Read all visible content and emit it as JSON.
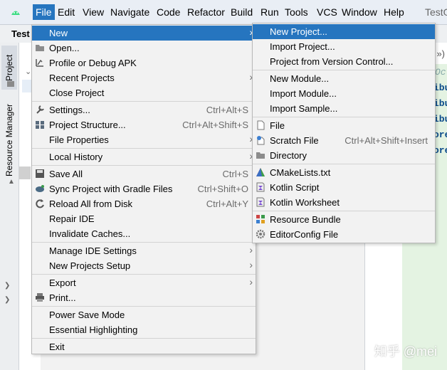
{
  "menubar": {
    "items": [
      "File",
      "Edit",
      "View",
      "Navigate",
      "Code",
      "Refactor",
      "Build",
      "Run",
      "Tools",
      "VCS",
      "Window",
      "Help"
    ],
    "title_fragment": "TestG"
  },
  "subbar": {
    "project_name": "Test"
  },
  "sidebar": {
    "project_label": "Project",
    "resource_manager_label": "Resource Manager"
  },
  "file_menu": {
    "items": [
      {
        "label": "New"
      },
      {
        "label": "Open..."
      },
      {
        "label": "Profile or Debug APK"
      },
      {
        "label": "Recent Projects"
      },
      {
        "label": "Close Project"
      },
      {
        "label": "Settings...",
        "shortcut": "Ctrl+Alt+S"
      },
      {
        "label": "Project Structure...",
        "shortcut": "Ctrl+Alt+Shift+S"
      },
      {
        "label": "File Properties"
      },
      {
        "label": "Local History"
      },
      {
        "label": "Save All",
        "shortcut": "Ctrl+S"
      },
      {
        "label": "Sync Project with Gradle Files",
        "shortcut": "Ctrl+Shift+O"
      },
      {
        "label": "Reload All from Disk",
        "shortcut": "Ctrl+Alt+Y"
      },
      {
        "label": "Repair IDE"
      },
      {
        "label": "Invalidate Caches..."
      },
      {
        "label": "Manage IDE Settings"
      },
      {
        "label": "New Projects Setup"
      },
      {
        "label": "Export"
      },
      {
        "label": "Print..."
      },
      {
        "label": "Power Save Mode"
      },
      {
        "label": "Essential Highlighting"
      },
      {
        "label": "Exit"
      }
    ]
  },
  "new_menu": {
    "items": [
      {
        "label": "New Project..."
      },
      {
        "label": "Import Project..."
      },
      {
        "label": "Project from Version Control..."
      },
      {
        "label": "New Module..."
      },
      {
        "label": "Import Module..."
      },
      {
        "label": "Import Sample..."
      },
      {
        "label": "File"
      },
      {
        "label": "Scratch File",
        "shortcut": "Ctrl+Alt+Shift+Insert"
      },
      {
        "label": "Directory"
      },
      {
        "label": "CMakeLists.txt"
      },
      {
        "label": "Kotlin Script"
      },
      {
        "label": "Kotlin Worksheet"
      },
      {
        "label": "Resource Bundle"
      },
      {
        "label": "EditorConfig File"
      }
    ]
  },
  "editor": {
    "tab_fragment": "»)",
    "lines": [
      "Oct",
      "ibu",
      "ibu",
      "ibu",
      "ore",
      "ore"
    ]
  },
  "watermark": "知乎 @mei",
  "colors": {
    "selection": "#2675bf",
    "menu_bg": "#f2f2f2",
    "editor_green": "#e4f3e2"
  }
}
